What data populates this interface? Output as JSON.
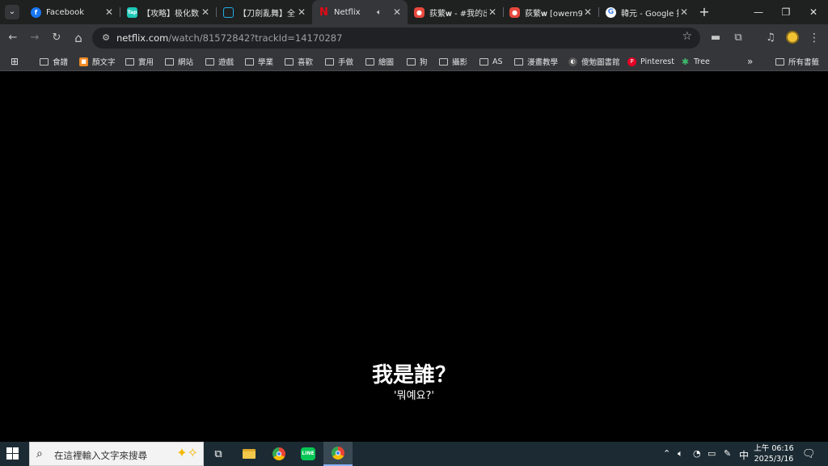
{
  "browser": {
    "tab_list_icon": "chevron-down-icon",
    "tabs": [
      {
        "title": "Facebook",
        "icon": "facebook-icon",
        "color": "#1877f2",
        "glyph": "f"
      },
      {
        "title": "【攻略】极化数",
        "icon": "app-icon",
        "color": "#1ec8b8",
        "glyph": "Tap"
      },
      {
        "title": "【刀劍亂舞】全",
        "icon": "bilibili-icon",
        "color": "#23ade5",
        "glyph": "▭"
      },
      {
        "title": "Netflix",
        "icon": "netflix-icon",
        "color": "#e50914",
        "glyph": "N",
        "active": true
      },
      {
        "title": "荻蘩𝐰 - #我的出",
        "icon": "profile-icon",
        "color": "#e8483d",
        "glyph": "●"
      },
      {
        "title": "荻蘩𝐰 [owern9",
        "icon": "profile-icon",
        "color": "#e8483d",
        "glyph": "●"
      },
      {
        "title": "韓元 - Google 搜",
        "icon": "google-icon",
        "color": "#ffffff",
        "glyph": "G"
      }
    ],
    "new_tab_label": "+",
    "window_controls": {
      "minimize": "—",
      "restore": "❐",
      "close": "✕"
    }
  },
  "toolbar": {
    "back": "←",
    "forward": "→",
    "reload": "↻",
    "home": "⌂",
    "url_domain": "netflix.com",
    "url_path": "/watch/81572842?trackId=14170287",
    "star": "☆"
  },
  "bookmarks": {
    "apps_icon": "apps-grid-icon",
    "items": [
      {
        "label": "食譜",
        "type": "folder"
      },
      {
        "label": "顏文字",
        "type": "site",
        "color": "#f08a24"
      },
      {
        "label": "實用",
        "type": "folder"
      },
      {
        "label": "網站",
        "type": "folder"
      },
      {
        "label": "遊戲",
        "type": "folder"
      },
      {
        "label": "學業",
        "type": "folder"
      },
      {
        "label": "喜歡",
        "type": "folder"
      },
      {
        "label": "手做",
        "type": "folder"
      },
      {
        "label": "繪圖",
        "type": "folder"
      },
      {
        "label": "狗",
        "type": "folder"
      },
      {
        "label": "攝影",
        "type": "folder"
      },
      {
        "label": "AS",
        "type": "folder"
      },
      {
        "label": "漫畫教學",
        "type": "folder"
      },
      {
        "label": "傻勉圖書館",
        "type": "site",
        "color": "#777777"
      },
      {
        "label": "Pinterest",
        "type": "site",
        "color": "#e60023"
      },
      {
        "label": "Tree",
        "type": "site",
        "color": "#3fba6b"
      }
    ],
    "overflow": "»",
    "all_bookmarks": "所有書籤"
  },
  "video": {
    "subtitle_main": "我是誰？",
    "subtitle_sub": "'뭐예요?'"
  },
  "taskbar": {
    "search_placeholder": "在這裡輸入文字來搜尋",
    "ime_label": "中",
    "time": "上午 06:16",
    "date": "2025/3/16"
  }
}
